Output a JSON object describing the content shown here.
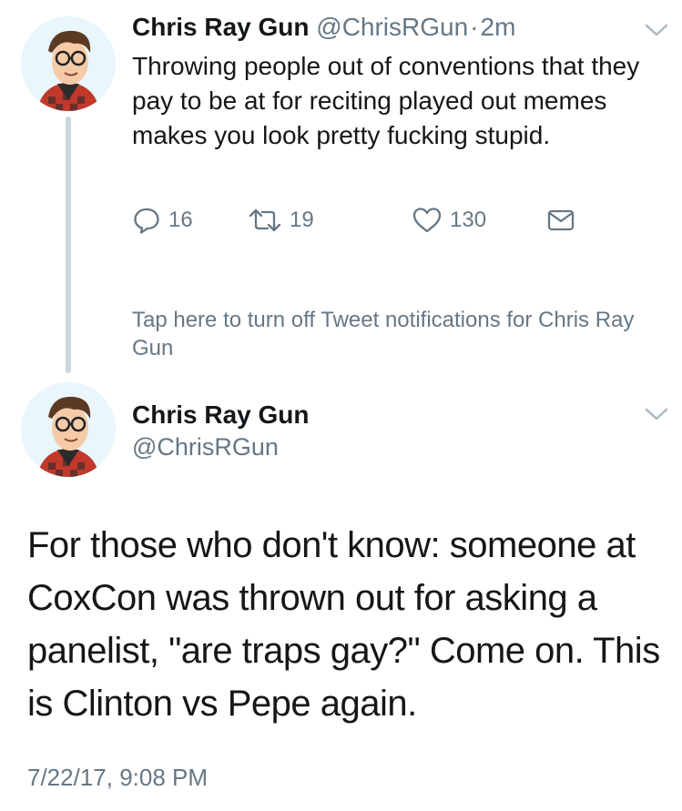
{
  "tweet1": {
    "author_name": "Chris Ray Gun",
    "author_handle": "@ChrisRGun",
    "separator": "·",
    "time": "2m",
    "text": "Throwing people out of conventions that they pay to be at for reciting played out memes makes you look pretty fucking stupid.",
    "reply_count": "16",
    "retweet_count": "19",
    "like_count": "130",
    "notification_text": "Tap here to turn off Tweet notifications for Chris Ray Gun"
  },
  "tweet2": {
    "author_name": "Chris Ray Gun",
    "author_handle": "@ChrisRGun",
    "text": "For those who don't know: someone at CoxCon was thrown out for asking a panelist, \"are traps gay?\" Come on. This is Clinton vs Pepe again.",
    "timestamp": "7/22/17, 9:08 PM"
  },
  "icons": {
    "reply": "reply-icon",
    "retweet": "retweet-icon",
    "like": "heart-icon",
    "dm": "envelope-icon",
    "menu": "chevron-down-icon",
    "avatar": "avatar-illustration"
  },
  "colors": {
    "text": "#14171a",
    "secondary": "#657786",
    "thread_line": "#ccd6dd",
    "avatar_bg": "#e9f6fb"
  }
}
